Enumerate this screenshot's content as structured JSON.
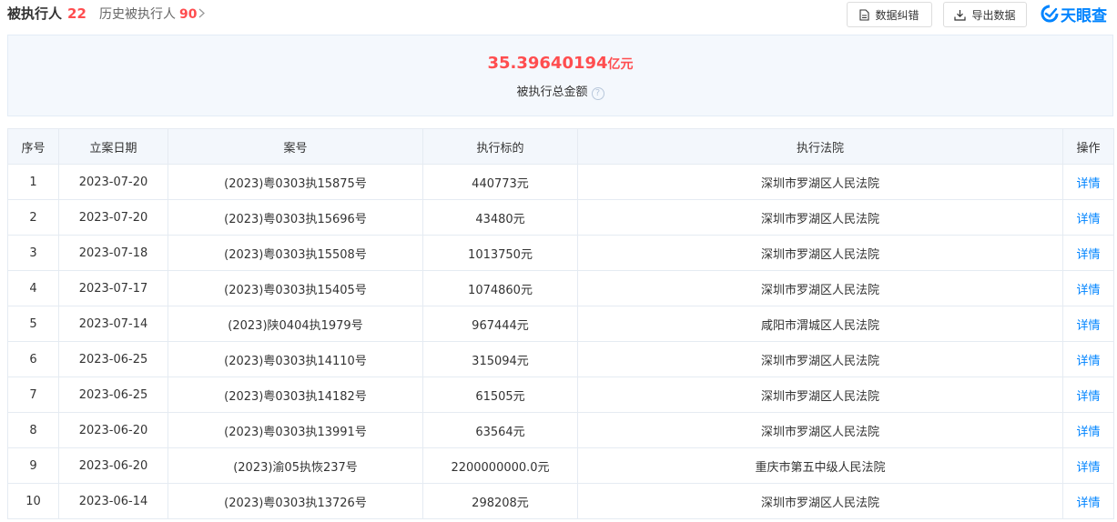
{
  "header": {
    "current_tab": {
      "label": "被执行人",
      "count": "22"
    },
    "history_tab": {
      "label": "历史被执行人",
      "count": "90"
    },
    "correct_button": "数据纠错",
    "export_button": "导出数据",
    "logo_text": "天眼查"
  },
  "summary": {
    "amount": "35.39640194",
    "unit": "亿元",
    "label": "被执行总金额",
    "help_glyph": "?"
  },
  "table": {
    "columns": [
      "序号",
      "立案日期",
      "案号",
      "执行标的",
      "执行法院",
      "操作"
    ],
    "rows": [
      {
        "no": "1",
        "date": "2023-07-20",
        "case": "(2023)粤0303执15875号",
        "amount": "440773元",
        "court": "深圳市罗湖区人民法院",
        "action": "详情"
      },
      {
        "no": "2",
        "date": "2023-07-20",
        "case": "(2023)粤0303执15696号",
        "amount": "43480元",
        "court": "深圳市罗湖区人民法院",
        "action": "详情"
      },
      {
        "no": "3",
        "date": "2023-07-18",
        "case": "(2023)粤0303执15508号",
        "amount": "1013750元",
        "court": "深圳市罗湖区人民法院",
        "action": "详情"
      },
      {
        "no": "4",
        "date": "2023-07-17",
        "case": "(2023)粤0303执15405号",
        "amount": "1074860元",
        "court": "深圳市罗湖区人民法院",
        "action": "详情"
      },
      {
        "no": "5",
        "date": "2023-07-14",
        "case": "(2023)陕0404执1979号",
        "amount": "967444元",
        "court": "咸阳市渭城区人民法院",
        "action": "详情"
      },
      {
        "no": "6",
        "date": "2023-06-25",
        "case": "(2023)粤0303执14110号",
        "amount": "315094元",
        "court": "深圳市罗湖区人民法院",
        "action": "详情"
      },
      {
        "no": "7",
        "date": "2023-06-25",
        "case": "(2023)粤0303执14182号",
        "amount": "61505元",
        "court": "深圳市罗湖区人民法院",
        "action": "详情"
      },
      {
        "no": "8",
        "date": "2023-06-20",
        "case": "(2023)粤0303执13991号",
        "amount": "63564元",
        "court": "深圳市罗湖区人民法院",
        "action": "详情"
      },
      {
        "no": "9",
        "date": "2023-06-20",
        "case": "(2023)渝05执恢237号",
        "amount": "2200000000.0元",
        "court": "重庆市第五中级人民法院",
        "action": "详情"
      },
      {
        "no": "10",
        "date": "2023-06-14",
        "case": "(2023)粤0303执13726号",
        "amount": "298208元",
        "court": "深圳市罗湖区人民法院",
        "action": "详情"
      }
    ]
  },
  "colors": {
    "accent": "#0084ff",
    "highlight": "#ff4d4f",
    "header_bg": "#f3f7fc",
    "summary_bg": "#f4f8fd"
  },
  "icons": {
    "correct": "document-icon",
    "export": "download-icon",
    "logo": "tianyancha-logo-icon",
    "history": "chevron-right-icon",
    "help": "question-icon"
  }
}
